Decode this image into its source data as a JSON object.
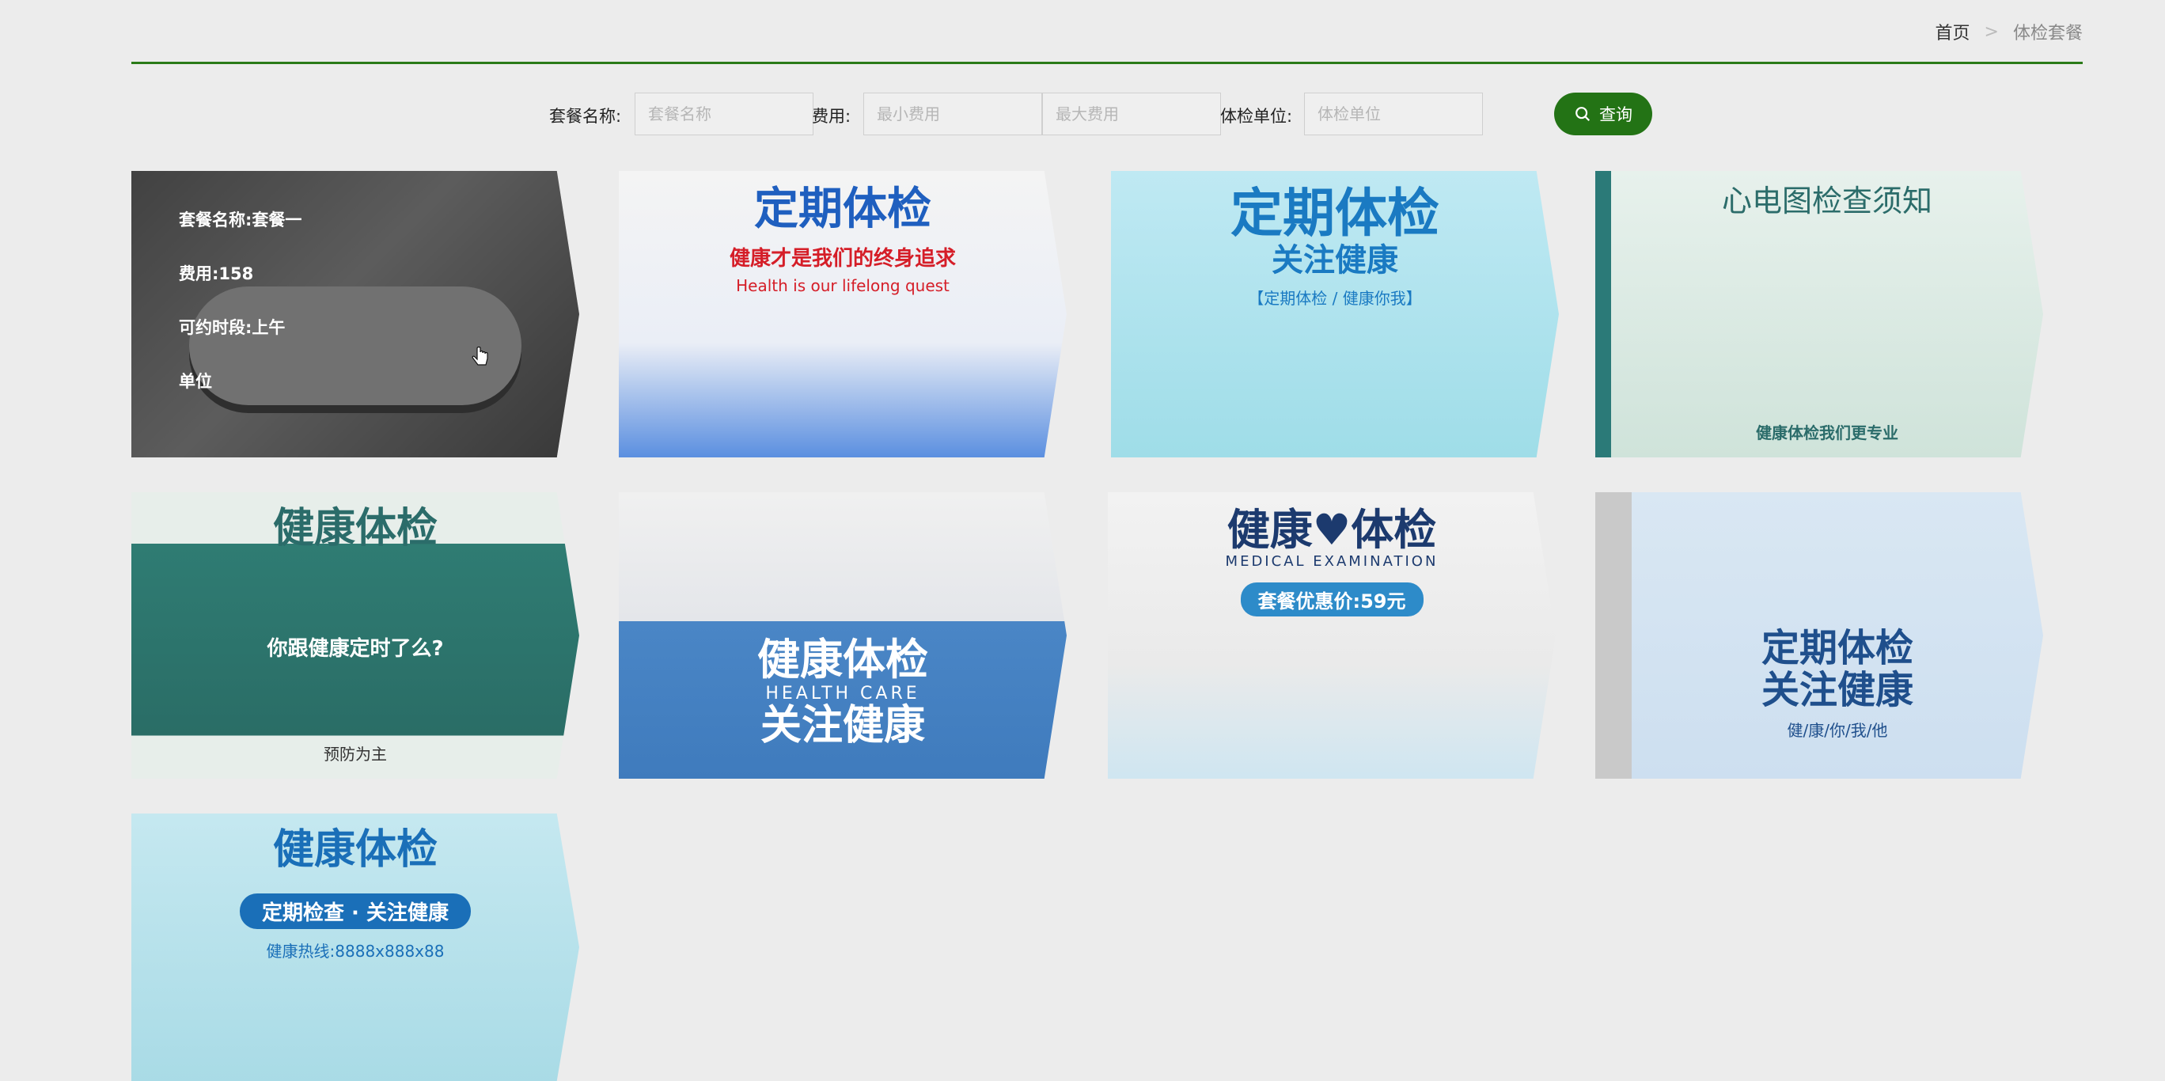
{
  "breadcrumb": {
    "home": "首页",
    "separator": ">",
    "current": "体检套餐"
  },
  "filters": {
    "name_label": "套餐名称:",
    "name_placeholder": "套餐名称",
    "fee_label": "费用:",
    "min_placeholder": "最小费用",
    "max_placeholder": "最大费用",
    "unit_label": "体检单位:",
    "unit_placeholder": "体检单位",
    "search_label": "查询"
  },
  "colors": {
    "accent": "#237315",
    "background": "#ececec"
  },
  "first_card_overlay": {
    "name": "套餐名称:套餐一",
    "fee": "费用:158",
    "period": "可约时段:上午",
    "unit": "单位"
  },
  "cards": [
    {
      "title": "",
      "sub": ""
    },
    {
      "title": "定期体检",
      "sub": "健康才是我们的终身追求",
      "sub2": "Health is our lifelong quest"
    },
    {
      "title": "定期体检",
      "sub": "关注健康",
      "sub2": "【定期体检 / 健康你我】"
    },
    {
      "title": "心电图检查须知",
      "sub": "健康体检我们更专业"
    },
    {
      "title": "健康体检",
      "sub": "你跟健康定时了么?",
      "sub2": "预防为主"
    },
    {
      "title": "健康体检",
      "sub": "关注健康",
      "sub2": "HEALTH CARE"
    },
    {
      "title": "健康♥体检",
      "sub": "MEDICAL EXAMINATION",
      "sub2": "套餐优惠价:59元"
    },
    {
      "title": "定期体检",
      "sub": "关注健康",
      "sub2": "健/康/你/我/他"
    },
    {
      "title": "健康体检",
      "sub": "定期检查 · 关注健康",
      "sub2": "健康热线:8888x888x88"
    }
  ]
}
